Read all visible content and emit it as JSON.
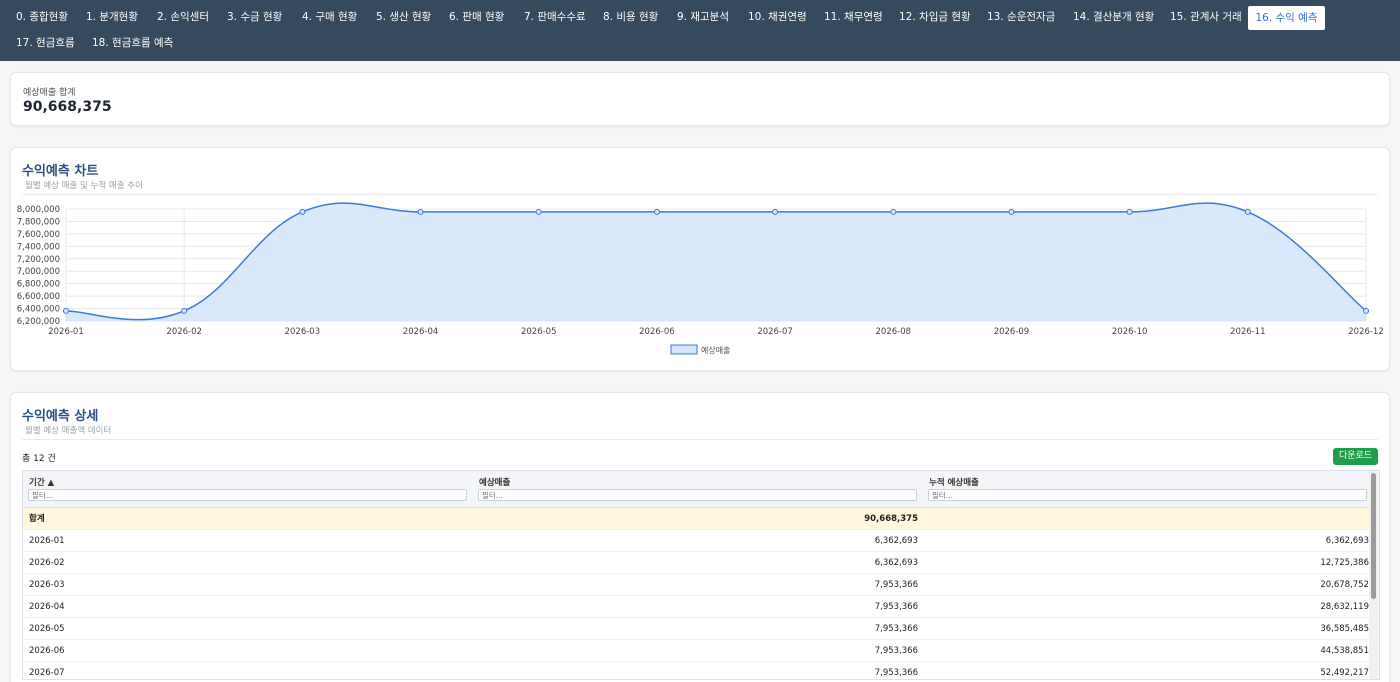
{
  "nav": {
    "tabs": [
      {
        "label": "0. 종합현황",
        "active": false
      },
      {
        "label": "1. 분개현황",
        "active": false
      },
      {
        "label": "2. 손익센터",
        "active": false
      },
      {
        "label": "3. 수금 현황",
        "active": false
      },
      {
        "label": "4. 구매 현황",
        "active": false
      },
      {
        "label": "5. 생산 현황",
        "active": false
      },
      {
        "label": "6. 판매 현황",
        "active": false
      },
      {
        "label": "7. 판매수수료",
        "active": false
      },
      {
        "label": "8. 비용 현황",
        "active": false
      },
      {
        "label": "9. 재고분석",
        "active": false
      },
      {
        "label": "10. 채권연령",
        "active": false
      },
      {
        "label": "11. 채무연령",
        "active": false
      },
      {
        "label": "12. 차입금 현황",
        "active": false
      },
      {
        "label": "13. 순운전자금",
        "active": false
      },
      {
        "label": "14. 결산분개 현황",
        "active": false
      },
      {
        "label": "15. 관계사 거래",
        "active": false
      },
      {
        "label": "16. 수익 예측",
        "active": true
      },
      {
        "label": "17. 현금흐름",
        "active": false
      },
      {
        "label": "18. 현금흐름 예측",
        "active": false
      }
    ]
  },
  "summary": {
    "label": "예상매출 합계",
    "value": "90,668,375"
  },
  "chart_section": {
    "title": "수익예측 차트",
    "subtitle": "월별 예상 매출 및 누적 매출 추이"
  },
  "chart_data": {
    "type": "area",
    "x": [
      "2026-01",
      "2026-02",
      "2026-03",
      "2026-04",
      "2026-05",
      "2026-06",
      "2026-07",
      "2026-08",
      "2026-09",
      "2026-10",
      "2026-11",
      "2026-12"
    ],
    "series": [
      {
        "name": "예상매출",
        "values": [
          6362693,
          6362693,
          7953366,
          7953366,
          7953366,
          7953366,
          7953366,
          7953366,
          7953366,
          7953366,
          7953366,
          6362693
        ]
      }
    ],
    "ylim": [
      6200000,
      8000000
    ],
    "yticks": [
      "8,000,000",
      "7,800,000",
      "7,600,000",
      "7,400,000",
      "7,200,000",
      "7,000,000",
      "6,800,000",
      "6,600,000",
      "6,400,000",
      "6,200,000"
    ],
    "grid": true,
    "legend": "bottom-center",
    "colors": {
      "line": "#3b7bd4",
      "fill": "#d6e5fb"
    }
  },
  "table_section": {
    "title": "수익예측 상세",
    "subtitle": "월별 예상 매출액 데이터",
    "count": "총 12 건",
    "download_label": "다운로드",
    "columns": [
      {
        "label": "기간 ▲",
        "filter_placeholder": "필터..."
      },
      {
        "label": "예상매출",
        "filter_placeholder": "필터..."
      },
      {
        "label": "누적 예상매출",
        "filter_placeholder": "필터..."
      }
    ],
    "total_row": {
      "period": "합계",
      "sales": "90,668,375",
      "cumulative": ""
    },
    "rows": [
      {
        "period": "2026-01",
        "sales": "6,362,693",
        "cumulative": "6,362,693"
      },
      {
        "period": "2026-02",
        "sales": "6,362,693",
        "cumulative": "12,725,386"
      },
      {
        "period": "2026-03",
        "sales": "7,953,366",
        "cumulative": "20,678,752"
      },
      {
        "period": "2026-04",
        "sales": "7,953,366",
        "cumulative": "28,632,119"
      },
      {
        "period": "2026-05",
        "sales": "7,953,366",
        "cumulative": "36,585,485"
      },
      {
        "period": "2026-06",
        "sales": "7,953,366",
        "cumulative": "44,538,851"
      },
      {
        "period": "2026-07",
        "sales": "7,953,366",
        "cumulative": "52,492,217"
      }
    ]
  }
}
